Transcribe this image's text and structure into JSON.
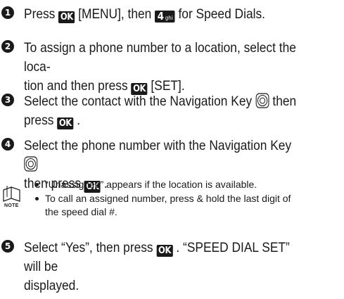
{
  "keys": {
    "ok": "OK",
    "four": "4",
    "four_sub": "ghi"
  },
  "steps": [
    {
      "num": "1",
      "a": "Press",
      "b": "[MENU], then",
      "c": "for Speed Dials."
    },
    {
      "num": "2",
      "a": "To assign a phone number to a location, select the loca-",
      "b": "tion and then press",
      "c": "[SET]."
    },
    {
      "num": "3",
      "a": "Select the contact with the Navigation Key",
      "b": "then",
      "c": "press",
      "d": "."
    },
    {
      "num": "4",
      "a": "Select the phone number with the Navigation Key",
      "b": "then press",
      "c": "."
    },
    {
      "num": "5",
      "a": "Select “Yes”, then press",
      "b": ". “SPEED DIAL SET” will be",
      "c": "displayed."
    }
  ],
  "note": {
    "label": "NOTE",
    "bullets": [
      "“Unassigned” appears if the location is available.",
      "To call an assigned number, press & hold the last digit of",
      "the speed dial #."
    ]
  }
}
